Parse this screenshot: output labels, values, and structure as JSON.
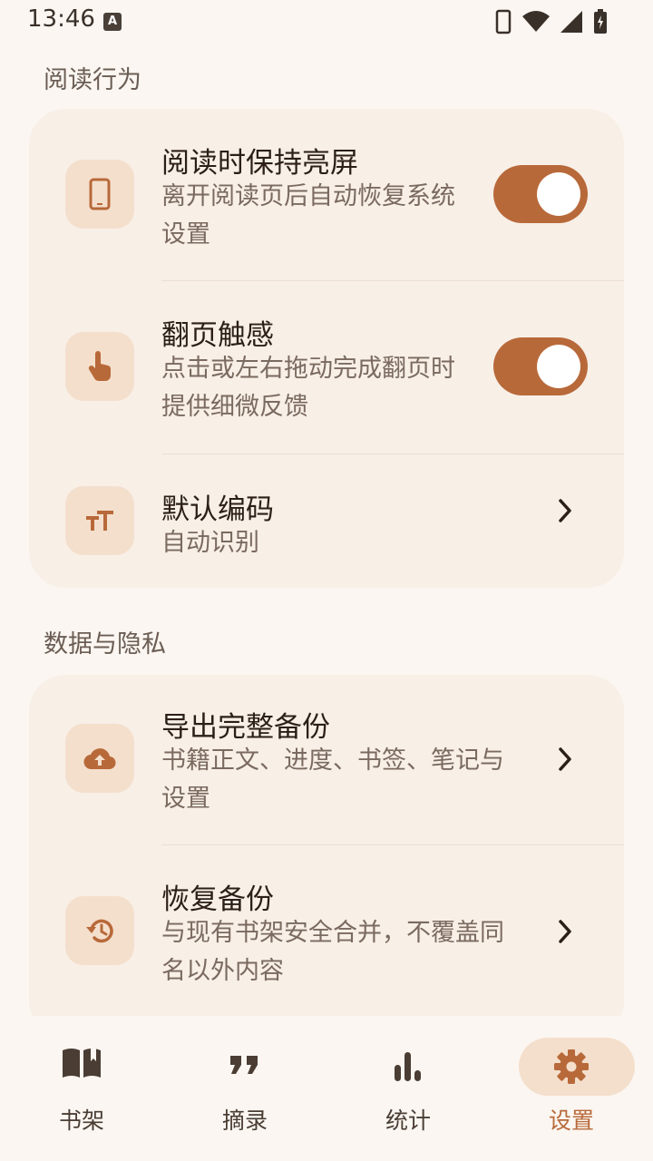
{
  "status_bar": {
    "time": "13:46",
    "keyboard_badge": "A"
  },
  "sections": [
    {
      "title": "阅读行为",
      "rows": [
        {
          "icon": "phone-icon",
          "title": "阅读时保持亮屏",
          "subtitle": "离开阅读页后自动恢复系统设置",
          "control": "toggle",
          "on": true
        },
        {
          "icon": "tap-hand-icon",
          "title": "翻页触感",
          "subtitle": "点击或左右拖动完成翻页时提供细微反馈",
          "control": "toggle",
          "on": true
        },
        {
          "icon": "text-size-icon",
          "title": "默认编码",
          "subtitle": "自动识别",
          "control": "chevron"
        }
      ]
    },
    {
      "title": "数据与隐私",
      "rows": [
        {
          "icon": "cloud-upload-icon",
          "title": "导出完整备份",
          "subtitle": "书籍正文、进度、书签、笔记与设置",
          "control": "chevron"
        },
        {
          "icon": "history-icon",
          "title": "恢复备份",
          "subtitle": "与现有书架安全合并，不覆盖同名以外内容",
          "control": "chevron"
        }
      ]
    }
  ],
  "nav": [
    {
      "label": "书架",
      "icon": "book-icon",
      "active": false
    },
    {
      "label": "摘录",
      "icon": "quote-icon",
      "active": false
    },
    {
      "label": "统计",
      "icon": "bar-chart-icon",
      "active": false
    },
    {
      "label": "设置",
      "icon": "gear-icon",
      "active": true
    }
  ],
  "colors": {
    "accent": "#b8693a",
    "icon_bg": "#f4dfcc",
    "card_bg": "#f8efe7",
    "page_bg": "#fbf6f1"
  }
}
